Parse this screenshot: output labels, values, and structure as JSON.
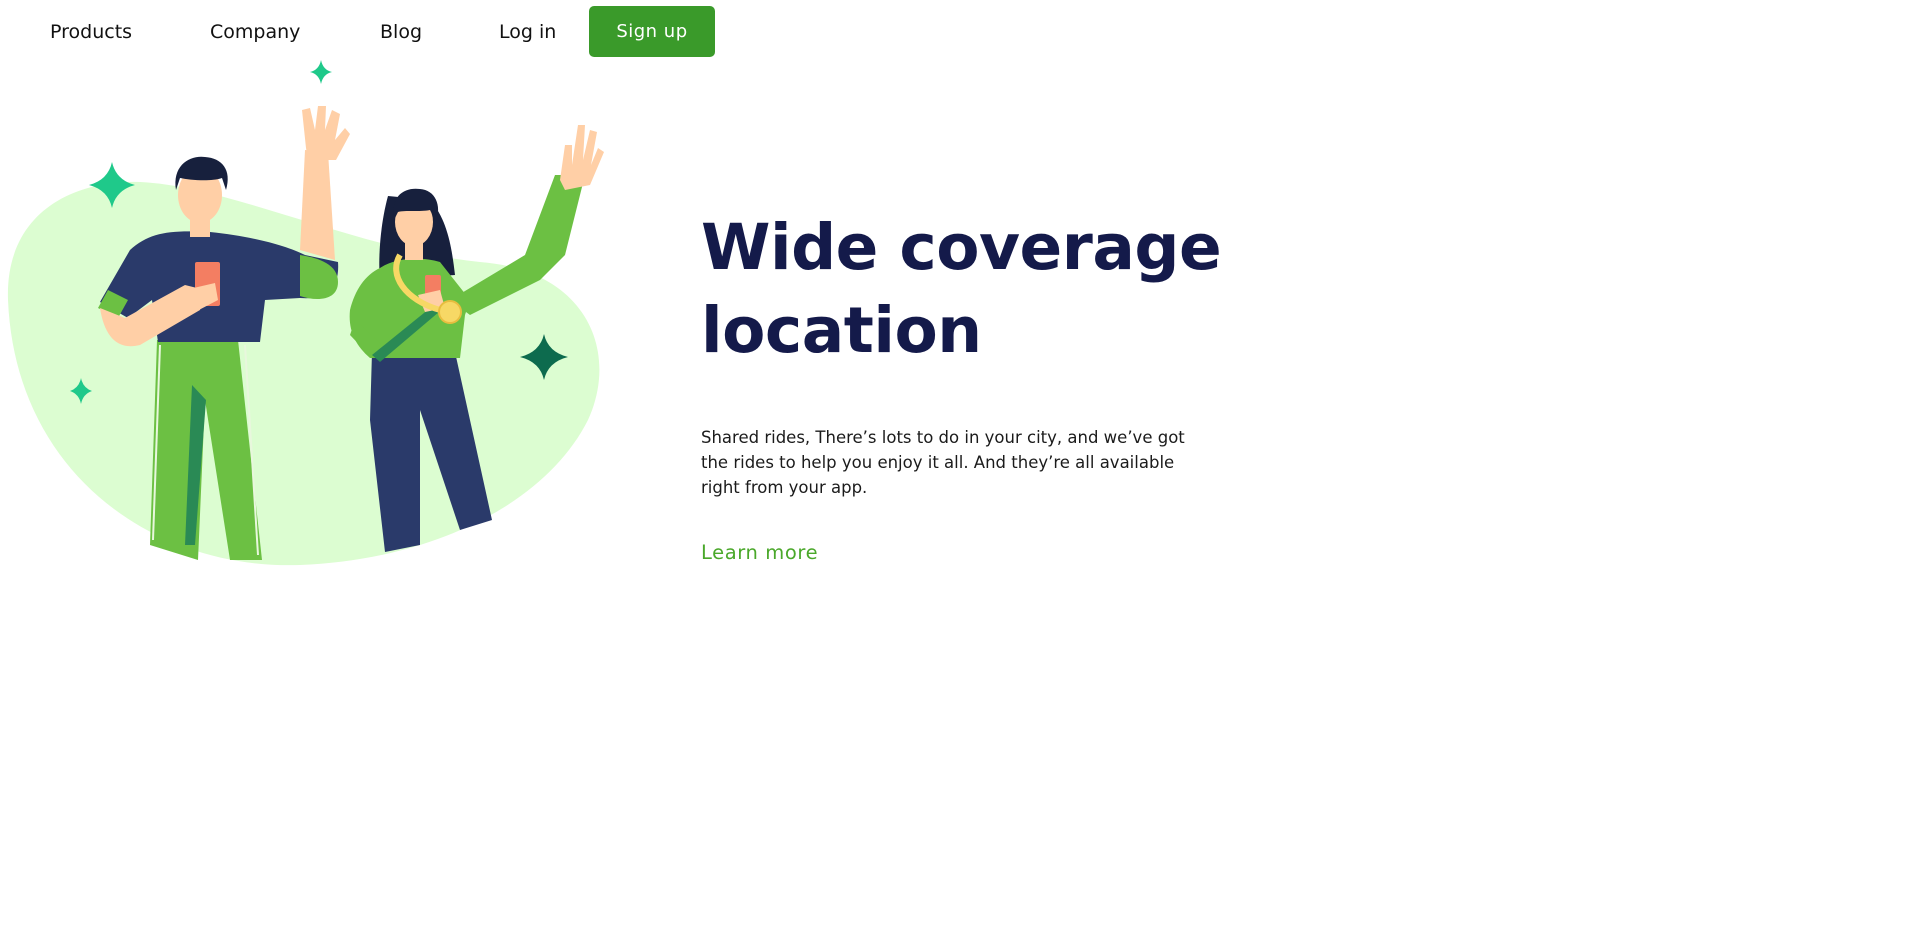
{
  "nav": {
    "items": [
      {
        "label": "Products"
      },
      {
        "label": "Company"
      },
      {
        "label": "Blog"
      },
      {
        "label": "Log in"
      }
    ],
    "signup_label": "Sign up"
  },
  "hero": {
    "headline": "Wide coverage location",
    "description": "Shared rides, There’s lots to do in your city, and we’ve got the rides to help you enjoy it all. And they’re all available right from your app.",
    "cta_label": "Learn more"
  },
  "illustration": {
    "subject": "two people waving",
    "icons": [
      "sparkle-icon"
    ]
  },
  "colors": {
    "brand_green": "#3a9a2a",
    "link_green": "#4aa82a",
    "headline_navy": "#141a4a",
    "blob_green": "#dcfdd1",
    "shirt_green": "#6cc043",
    "navy": "#2a3a6a",
    "sparkle": "#1fc98a",
    "sparkle_dark": "#0d6b4e"
  }
}
